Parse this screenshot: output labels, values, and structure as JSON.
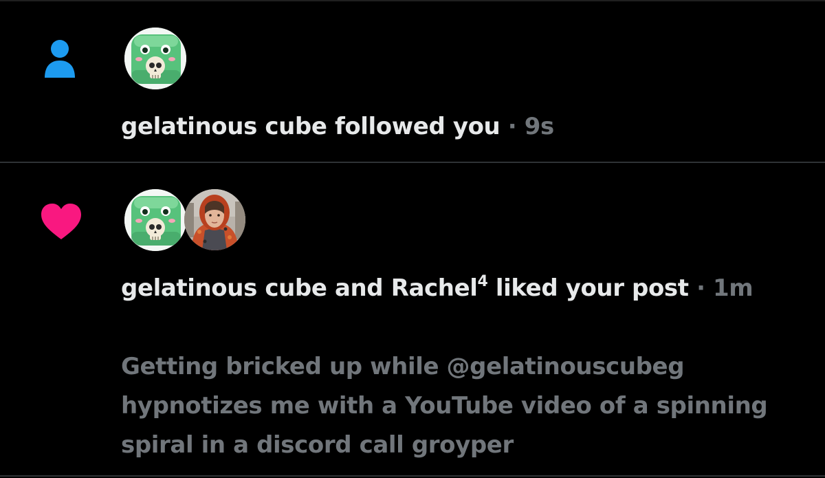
{
  "notifications": [
    {
      "type": "follow",
      "icon": "person-icon",
      "icon_color": "#1d9bf0",
      "user": "gelatinous cube",
      "action": "followed you",
      "separator": "·",
      "time": "9s"
    },
    {
      "type": "like",
      "icon": "heart-icon",
      "icon_color": "#f91880",
      "user_1": "gelatinous cube",
      "conjunction": "and",
      "user_2": "Rachel",
      "user_2_superscript": "4",
      "action": "liked your post",
      "separator": "·",
      "time": "1m",
      "post_text": "Getting bricked up while @gelatinouscubeg hypnotizes me with a YouTube video of a spinning spiral in a discord call groyper"
    }
  ],
  "colors": {
    "background": "#000000",
    "primary_text": "#e7e9ea",
    "secondary_text": "#71767b",
    "divider": "#2f3336"
  }
}
